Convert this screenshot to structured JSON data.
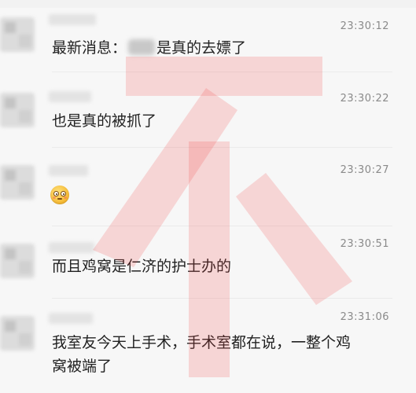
{
  "messages": [
    {
      "time": "23:30:12",
      "text_before": "最新消息：",
      "text_after": "是真的去嫖了",
      "has_blurred_name": true
    },
    {
      "time": "23:30:22",
      "text": "也是真的被抓了"
    },
    {
      "time": "23:30:27",
      "emoji": "flushed-face-emoji"
    },
    {
      "time": "23:30:51",
      "text": "而且鸡窝是仁济的护士办的"
    },
    {
      "time": "23:31:06",
      "text_line1": "我室友今天上手术，手术室都在说，一整个鸡",
      "text_line2": "窝被端了"
    }
  ],
  "watermark": {
    "glyph": "不",
    "color": "#f23c3c",
    "opacity": 0.18
  },
  "colors": {
    "background": "#f7f7f7",
    "text": "#222222",
    "timestamp": "#8a8a8a"
  }
}
